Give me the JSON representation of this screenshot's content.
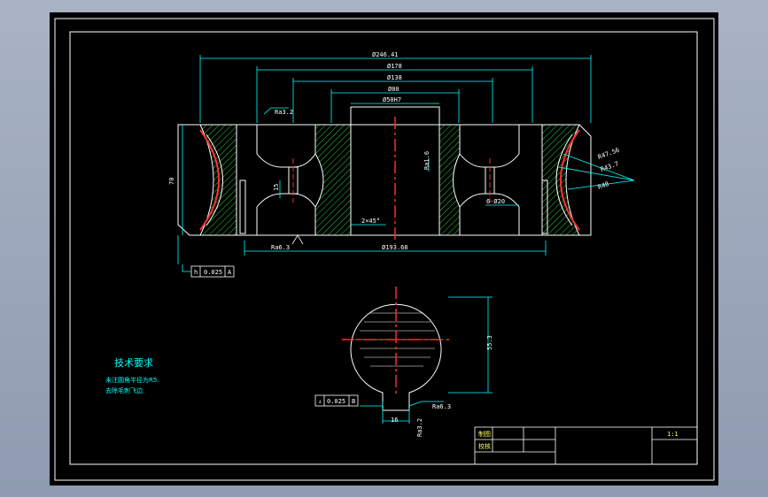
{
  "dimensions": {
    "overall_dia": "Ø246.41",
    "outer_dia": "Ø178",
    "dia_138": "Ø138",
    "dia_80": "Ø80",
    "bore_dia": "Ø50H7",
    "groove_r1": "R47.56",
    "groove_r2": "R43.7",
    "groove_r3": "R48",
    "height": "70",
    "web_width": "15",
    "slot_width": "16",
    "chamfer": "2×45°",
    "holes": "6-Ø20",
    "base_dia": "Ø193.68",
    "keyway_depth": "55.3",
    "key_width": "16"
  },
  "roughness": {
    "top": "Ra3.2",
    "bore": "Ra1.6",
    "bottom": "Ra6.3",
    "section": "Ra6.3",
    "key": "Ra3.2"
  },
  "tolerance_1": {
    "symbol": "h",
    "value": "0.025",
    "datum": "A"
  },
  "tolerance_2": {
    "symbol": "↓",
    "value": "0.025",
    "datum": "B"
  },
  "tech_requirements": {
    "title": "技术要求",
    "line1": "未注圆角半径为R5.",
    "line2": "去除毛刺飞边."
  },
  "title_block": {
    "drawn_label": "制图",
    "checked_label": "校核",
    "scale": "1:1"
  },
  "colors": {
    "background": "#000000",
    "outline": "#ffffff",
    "dimension": "#00ffff",
    "hatch": "#2ecc40",
    "centerline": "#ff2a2a",
    "contour": "#ff3030"
  }
}
